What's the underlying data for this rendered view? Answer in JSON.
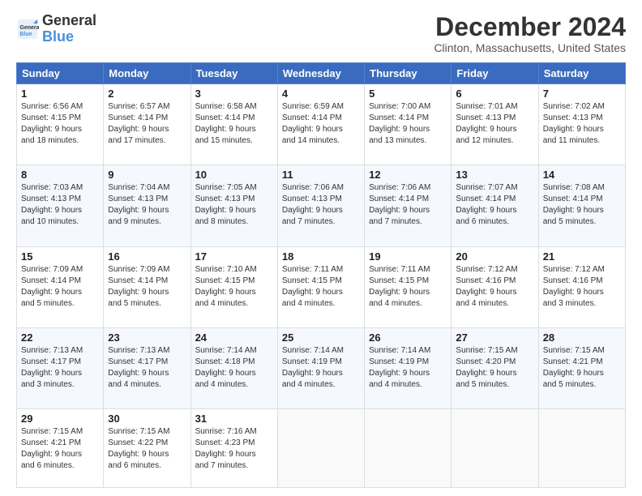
{
  "header": {
    "logo_line1": "General",
    "logo_line2": "Blue",
    "month": "December 2024",
    "location": "Clinton, Massachusetts, United States"
  },
  "weekdays": [
    "Sunday",
    "Monday",
    "Tuesday",
    "Wednesday",
    "Thursday",
    "Friday",
    "Saturday"
  ],
  "weeks": [
    [
      {
        "day": "1",
        "lines": [
          "Sunrise: 6:56 AM",
          "Sunset: 4:15 PM",
          "Daylight: 9 hours",
          "and 18 minutes."
        ]
      },
      {
        "day": "2",
        "lines": [
          "Sunrise: 6:57 AM",
          "Sunset: 4:14 PM",
          "Daylight: 9 hours",
          "and 17 minutes."
        ]
      },
      {
        "day": "3",
        "lines": [
          "Sunrise: 6:58 AM",
          "Sunset: 4:14 PM",
          "Daylight: 9 hours",
          "and 15 minutes."
        ]
      },
      {
        "day": "4",
        "lines": [
          "Sunrise: 6:59 AM",
          "Sunset: 4:14 PM",
          "Daylight: 9 hours",
          "and 14 minutes."
        ]
      },
      {
        "day": "5",
        "lines": [
          "Sunrise: 7:00 AM",
          "Sunset: 4:14 PM",
          "Daylight: 9 hours",
          "and 13 minutes."
        ]
      },
      {
        "day": "6",
        "lines": [
          "Sunrise: 7:01 AM",
          "Sunset: 4:13 PM",
          "Daylight: 9 hours",
          "and 12 minutes."
        ]
      },
      {
        "day": "7",
        "lines": [
          "Sunrise: 7:02 AM",
          "Sunset: 4:13 PM",
          "Daylight: 9 hours",
          "and 11 minutes."
        ]
      }
    ],
    [
      {
        "day": "8",
        "lines": [
          "Sunrise: 7:03 AM",
          "Sunset: 4:13 PM",
          "Daylight: 9 hours",
          "and 10 minutes."
        ]
      },
      {
        "day": "9",
        "lines": [
          "Sunrise: 7:04 AM",
          "Sunset: 4:13 PM",
          "Daylight: 9 hours",
          "and 9 minutes."
        ]
      },
      {
        "day": "10",
        "lines": [
          "Sunrise: 7:05 AM",
          "Sunset: 4:13 PM",
          "Daylight: 9 hours",
          "and 8 minutes."
        ]
      },
      {
        "day": "11",
        "lines": [
          "Sunrise: 7:06 AM",
          "Sunset: 4:13 PM",
          "Daylight: 9 hours",
          "and 7 minutes."
        ]
      },
      {
        "day": "12",
        "lines": [
          "Sunrise: 7:06 AM",
          "Sunset: 4:14 PM",
          "Daylight: 9 hours",
          "and 7 minutes."
        ]
      },
      {
        "day": "13",
        "lines": [
          "Sunrise: 7:07 AM",
          "Sunset: 4:14 PM",
          "Daylight: 9 hours",
          "and 6 minutes."
        ]
      },
      {
        "day": "14",
        "lines": [
          "Sunrise: 7:08 AM",
          "Sunset: 4:14 PM",
          "Daylight: 9 hours",
          "and 5 minutes."
        ]
      }
    ],
    [
      {
        "day": "15",
        "lines": [
          "Sunrise: 7:09 AM",
          "Sunset: 4:14 PM",
          "Daylight: 9 hours",
          "and 5 minutes."
        ]
      },
      {
        "day": "16",
        "lines": [
          "Sunrise: 7:09 AM",
          "Sunset: 4:14 PM",
          "Daylight: 9 hours",
          "and 5 minutes."
        ]
      },
      {
        "day": "17",
        "lines": [
          "Sunrise: 7:10 AM",
          "Sunset: 4:15 PM",
          "Daylight: 9 hours",
          "and 4 minutes."
        ]
      },
      {
        "day": "18",
        "lines": [
          "Sunrise: 7:11 AM",
          "Sunset: 4:15 PM",
          "Daylight: 9 hours",
          "and 4 minutes."
        ]
      },
      {
        "day": "19",
        "lines": [
          "Sunrise: 7:11 AM",
          "Sunset: 4:15 PM",
          "Daylight: 9 hours",
          "and 4 minutes."
        ]
      },
      {
        "day": "20",
        "lines": [
          "Sunrise: 7:12 AM",
          "Sunset: 4:16 PM",
          "Daylight: 9 hours",
          "and 4 minutes."
        ]
      },
      {
        "day": "21",
        "lines": [
          "Sunrise: 7:12 AM",
          "Sunset: 4:16 PM",
          "Daylight: 9 hours",
          "and 3 minutes."
        ]
      }
    ],
    [
      {
        "day": "22",
        "lines": [
          "Sunrise: 7:13 AM",
          "Sunset: 4:17 PM",
          "Daylight: 9 hours",
          "and 3 minutes."
        ]
      },
      {
        "day": "23",
        "lines": [
          "Sunrise: 7:13 AM",
          "Sunset: 4:17 PM",
          "Daylight: 9 hours",
          "and 4 minutes."
        ]
      },
      {
        "day": "24",
        "lines": [
          "Sunrise: 7:14 AM",
          "Sunset: 4:18 PM",
          "Daylight: 9 hours",
          "and 4 minutes."
        ]
      },
      {
        "day": "25",
        "lines": [
          "Sunrise: 7:14 AM",
          "Sunset: 4:19 PM",
          "Daylight: 9 hours",
          "and 4 minutes."
        ]
      },
      {
        "day": "26",
        "lines": [
          "Sunrise: 7:14 AM",
          "Sunset: 4:19 PM",
          "Daylight: 9 hours",
          "and 4 minutes."
        ]
      },
      {
        "day": "27",
        "lines": [
          "Sunrise: 7:15 AM",
          "Sunset: 4:20 PM",
          "Daylight: 9 hours",
          "and 5 minutes."
        ]
      },
      {
        "day": "28",
        "lines": [
          "Sunrise: 7:15 AM",
          "Sunset: 4:21 PM",
          "Daylight: 9 hours",
          "and 5 minutes."
        ]
      }
    ],
    [
      {
        "day": "29",
        "lines": [
          "Sunrise: 7:15 AM",
          "Sunset: 4:21 PM",
          "Daylight: 9 hours",
          "and 6 minutes."
        ]
      },
      {
        "day": "30",
        "lines": [
          "Sunrise: 7:15 AM",
          "Sunset: 4:22 PM",
          "Daylight: 9 hours",
          "and 6 minutes."
        ]
      },
      {
        "day": "31",
        "lines": [
          "Sunrise: 7:16 AM",
          "Sunset: 4:23 PM",
          "Daylight: 9 hours",
          "and 7 minutes."
        ]
      },
      null,
      null,
      null,
      null
    ]
  ]
}
